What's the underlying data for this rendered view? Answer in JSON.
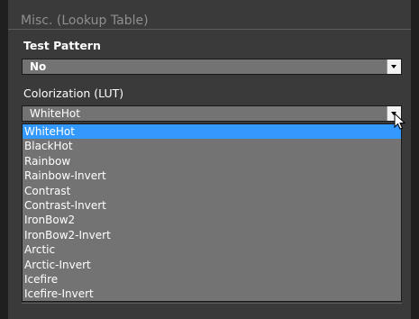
{
  "section": {
    "title": "Misc. (Lookup Table)"
  },
  "test_pattern": {
    "label": "Test Pattern",
    "value": "No"
  },
  "colorization": {
    "label": "Colorization (LUT)",
    "value": "WhiteHot",
    "options": [
      "WhiteHot",
      "BlackHot",
      "Rainbow",
      "Rainbow-Invert",
      "Contrast",
      "Contrast-Invert",
      "IronBow2",
      "IronBow2-Invert",
      "Arctic",
      "Arctic-Invert",
      "Icefire",
      "Icefire-Invert"
    ],
    "highlighted_index": 0
  },
  "colors": {
    "highlight": "#3399ff",
    "panel": "#3a3a3a",
    "field": "#737373"
  },
  "icons": {
    "dropdown_arrow": "chevron-down-icon",
    "cursor": "mouse-pointer-icon"
  }
}
